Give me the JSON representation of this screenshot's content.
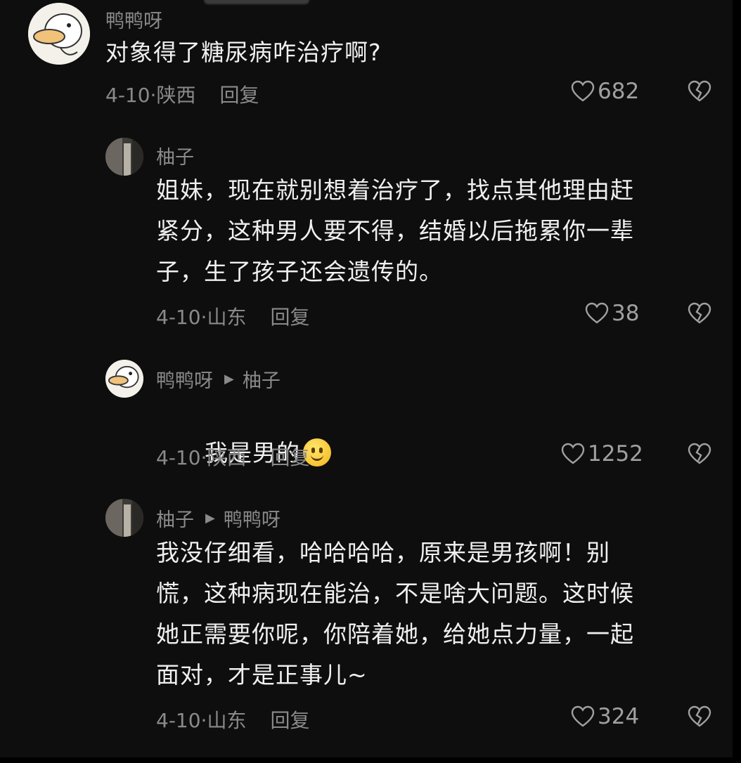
{
  "comments": [
    {
      "username": "鸭鸭呀",
      "reply_to": "",
      "text": "对象得了糖尿病咋治疗啊?",
      "date": "4-10",
      "location": "陕西",
      "reply_label": "回复",
      "likes": "682",
      "avatar": "duck-avatar"
    },
    {
      "username": "柚子",
      "reply_to": "",
      "text": "姐妹，现在就别想着治疗了，找点其他理由赶\n紧分，这种男人要不得，结婚以后拖累你一辈\n子，生了孩子还会遗传的。",
      "date": "4-10",
      "location": "山东",
      "reply_label": "回复",
      "likes": "38",
      "avatar": "photo-avatar"
    },
    {
      "username": "鸭鸭呀",
      "reply_to": "柚子",
      "text": "我是男的",
      "emoji": "slightly-smiling-face",
      "date": "4-10",
      "location": "陕西",
      "reply_label": "回复",
      "likes": "1252",
      "avatar": "duck-avatar"
    },
    {
      "username": "柚子",
      "reply_to": "鸭鸭呀",
      "text": "我没仔细看，哈哈哈哈，原来是男孩啊！别\n慌，这种病现在能治，不是啥大问题。这时候\n她正需要你呢，你陪着她，给她点力量，一起\n面对，才是正事儿~",
      "date": "4-10",
      "location": "山东",
      "reply_label": "回复",
      "likes": "324",
      "avatar": "photo-avatar"
    }
  ],
  "colors": {
    "background": "#0e0e0e",
    "text": "#f0f0f0",
    "muted": "#8a8a8a"
  }
}
